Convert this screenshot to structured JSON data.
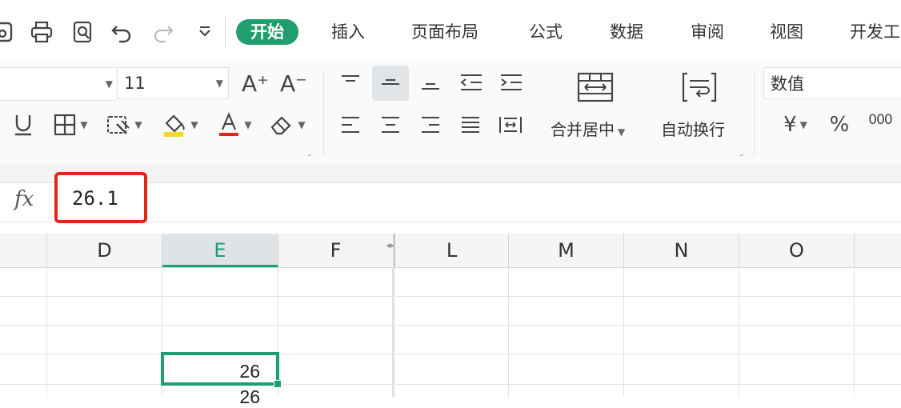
{
  "quick_access": {
    "icons": [
      "save-icon",
      "print-icon",
      "print-preview-icon",
      "undo-icon",
      "redo-icon",
      "customize-dropdown-icon"
    ]
  },
  "tabs": [
    {
      "label": "开始",
      "active": true
    },
    {
      "label": "插入",
      "active": false
    },
    {
      "label": "页面布局",
      "active": false
    },
    {
      "label": "公式",
      "active": false
    },
    {
      "label": "数据",
      "active": false
    },
    {
      "label": "审阅",
      "active": false
    },
    {
      "label": "视图",
      "active": false
    },
    {
      "label": "开发工",
      "active": false
    }
  ],
  "ribbon": {
    "font_size": "11",
    "increase_font": "A⁺",
    "decrease_font": "A⁻",
    "merge_label": "合并居中",
    "wrap_label": "自动换行",
    "number_format": "数值",
    "currency_symbol": "¥",
    "percent_symbol": "%",
    "thousands_symbol": "000"
  },
  "formula_bar": {
    "fx_label": "fx",
    "value": "26.1"
  },
  "columns": [
    {
      "label": "D",
      "selected": false
    },
    {
      "label": "E",
      "selected": true
    },
    {
      "label": "F",
      "selected": false
    },
    {
      "label": "L",
      "selected": false
    },
    {
      "label": "M",
      "selected": false
    },
    {
      "label": "N",
      "selected": false
    },
    {
      "label": "O",
      "selected": false
    }
  ],
  "cells": {
    "e_active": "26",
    "e_next": "26"
  },
  "colors": {
    "accent": "#1f9e6e",
    "highlight_border": "#e0251b"
  }
}
